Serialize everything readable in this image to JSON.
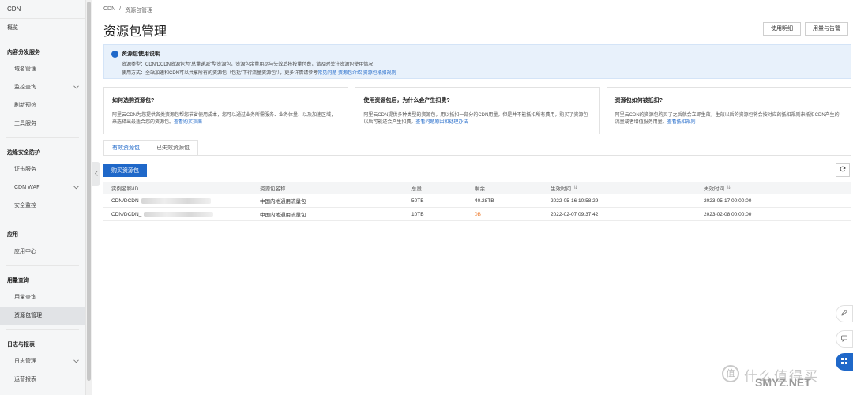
{
  "sidebar": {
    "title": "CDN",
    "overview": "概览",
    "groups": [
      {
        "title": "内容分发服务",
        "items": [
          {
            "label": "域名管理",
            "chevron": false
          },
          {
            "label": "监控查询",
            "chevron": true
          },
          {
            "label": "刷新预热",
            "chevron": false
          },
          {
            "label": "工具服务",
            "chevron": false
          }
        ]
      },
      {
        "title": "边缘安全防护",
        "items": [
          {
            "label": "证书服务",
            "chevron": false
          },
          {
            "label": "CDN WAF",
            "chevron": true
          },
          {
            "label": "安全监控",
            "chevron": false
          }
        ]
      },
      {
        "title": "应用",
        "items": [
          {
            "label": "应用中心",
            "chevron": false
          }
        ]
      },
      {
        "title": "用量查询",
        "items": [
          {
            "label": "用量查询",
            "chevron": false
          },
          {
            "label": "资源包管理",
            "chevron": false,
            "active": true
          }
        ]
      },
      {
        "title": "日志与报表",
        "items": [
          {
            "label": "日志管理",
            "chevron": true
          },
          {
            "label": "运营报表",
            "chevron": false
          }
        ]
      }
    ]
  },
  "breadcrumb": {
    "root": "CDN",
    "sep": "/",
    "current": "资源包管理"
  },
  "page_title": "资源包管理",
  "top_buttons": {
    "usage_notes": "使用明细",
    "usage_alert": "用量与告警"
  },
  "info": {
    "title": "资源包使用说明",
    "line1": "资源类型：CDN/DCDN资源包为\"总量递减\"型资源包，资源包余量用尽与失效后将按量付费，请及时关注资源包使用情况",
    "line2_prefix": "使用方式：全站加速和CDN可以共享所有的资源包（包括\"下行流量资源包\"），更多详情请参考",
    "link1": "常见问题",
    "link2": "资源包介绍",
    "link3": "资源包抵扣规则"
  },
  "cards": [
    {
      "title": "如何选购资源包?",
      "body": "阿里云CDN为您提供各类资源包帮您节省使用成本，您可以通过业务所需服务、业务体量、以及加速区域，来选择出最适合您的资源包。",
      "link": "查看购买指南"
    },
    {
      "title": "使用资源包后，为什么会产生扣费?",
      "body": "阿里云CDN提供多种类型的资源包，用以抵扣一部分的CDN用量，但是并不能抵扣所有费用，购买了资源包以后可能还会产生扣费。",
      "link": "查看问题原因和处理办法"
    },
    {
      "title": "资源包如何被抵扣?",
      "body": "阿里云CDN的资源包购买了之后就会立即生效，生效以后的资源包将会按对应的抵扣规则来抵扣CDN产生的流量或者增值服务用量。",
      "link": "查看抵扣规则"
    }
  ],
  "tabs": {
    "active": "有效资源包",
    "expired": "已失效资源包"
  },
  "buy_button": "购买资源包",
  "table": {
    "headers": [
      "实例名称/ID",
      "资源包名称",
      "总量",
      "剩余",
      "生效时间",
      "失效时间"
    ],
    "rows": [
      {
        "id": "CDN/DCDN",
        "name": "中国内地通用流量包",
        "total": "50TB",
        "remain": "40.28TB",
        "start": "2022-05-16 10:58:29",
        "end": "2023-05-17 00:00:00"
      },
      {
        "id": "CDN/DCDN_",
        "name": "中国内地通用流量包",
        "total": "10TB",
        "remain": "0B",
        "start": "2022-02-07 09:37:42",
        "end": "2023-02-08 00:00:00"
      }
    ]
  },
  "watermark": {
    "text": "什么值得买",
    "site": "SMYZ.NET"
  },
  "colors": {
    "accent": "#1f68c9",
    "warning": "#ee7a2b",
    "info_bg": "#e8f1fb"
  }
}
